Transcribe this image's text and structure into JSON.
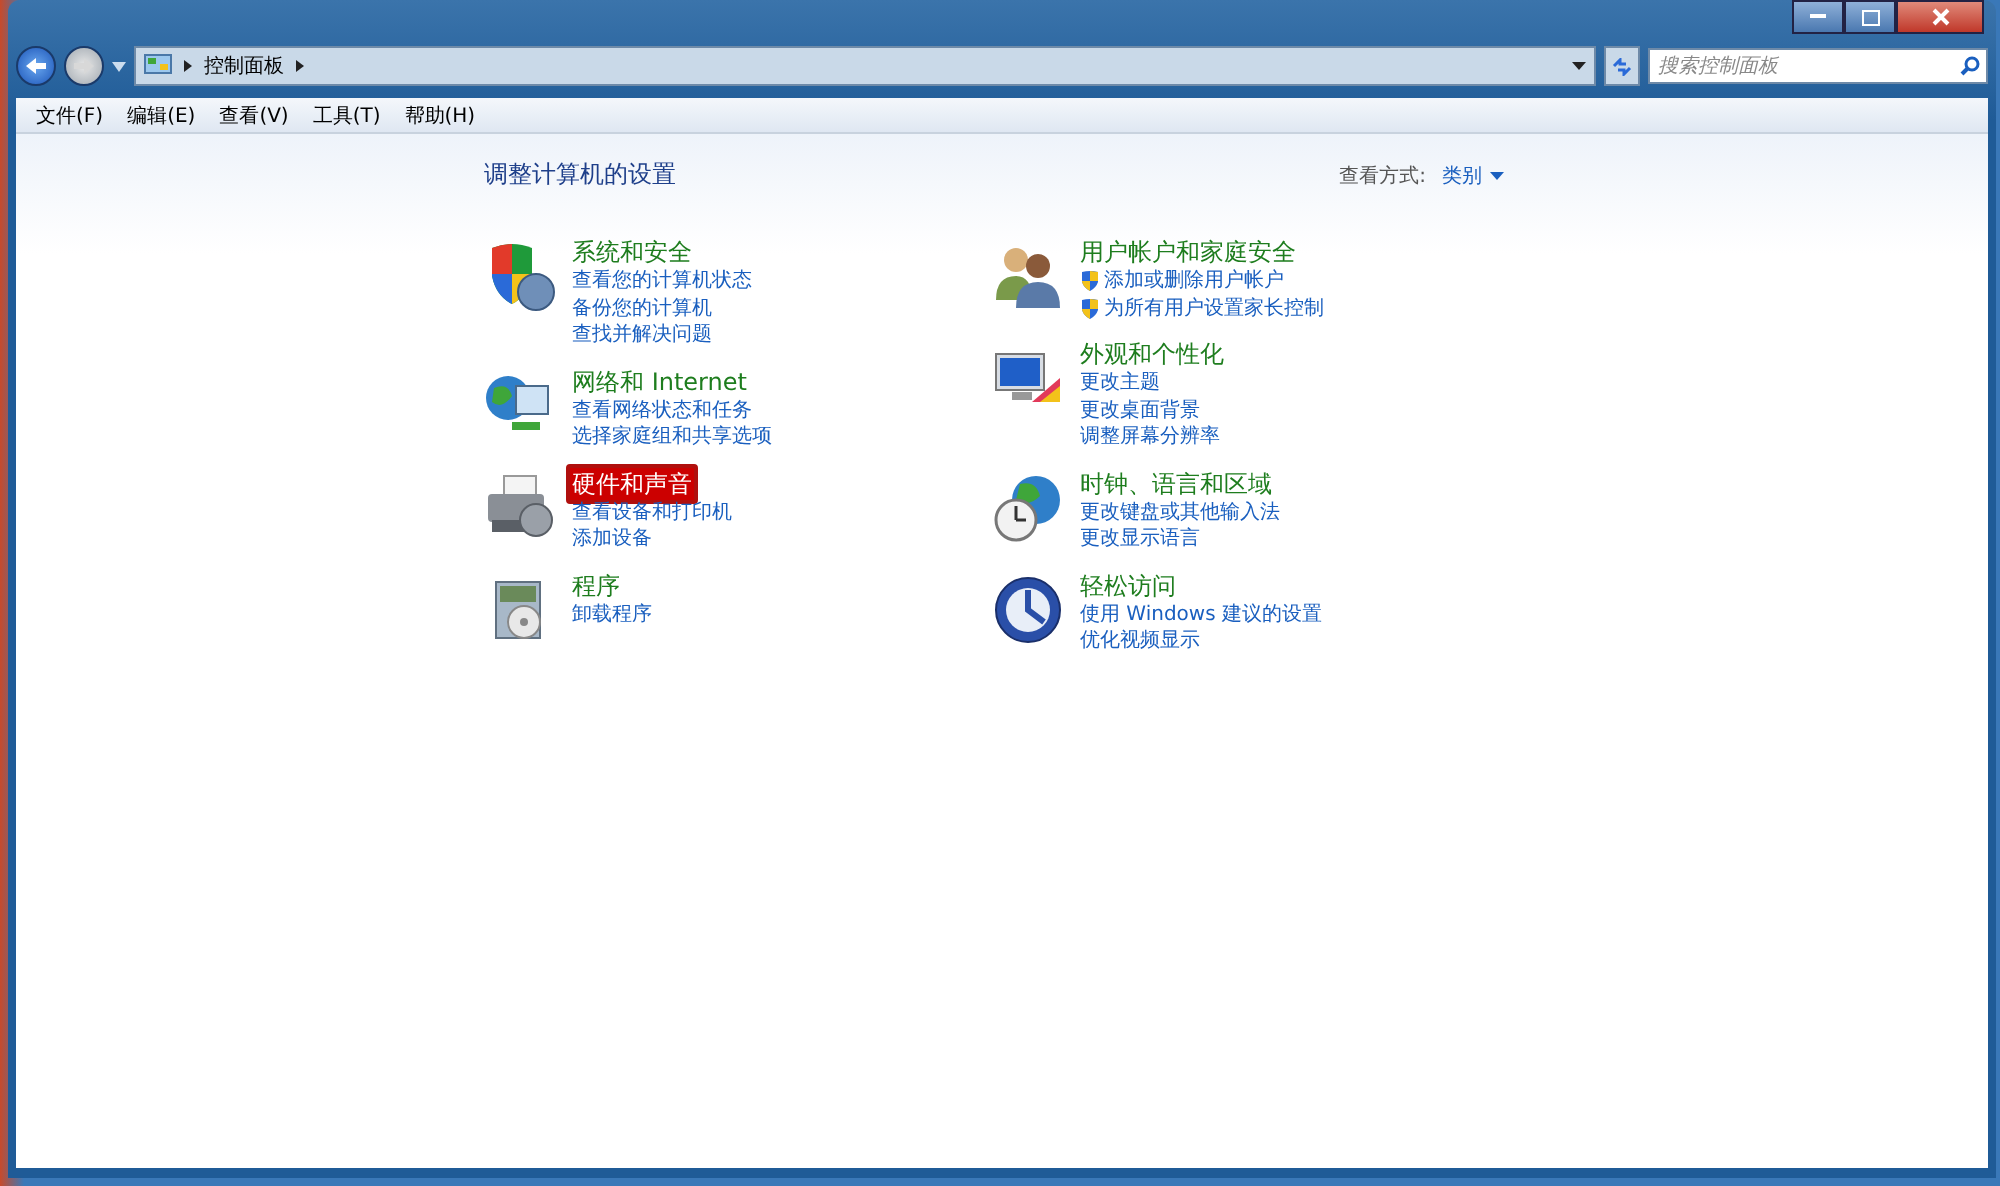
{
  "address_bar": {
    "path": [
      "控制面板"
    ]
  },
  "search": {
    "placeholder": "搜索控制面板"
  },
  "menu_bar": [
    "文件(F)",
    "编辑(E)",
    "查看(V)",
    "工具(T)",
    "帮助(H)"
  ],
  "heading": "调整计算机的设置",
  "view_by": {
    "label": "查看方式:",
    "value": "类别"
  },
  "columns": [
    [
      {
        "title": "系统和安全",
        "highlighted": false,
        "links": [
          {
            "text": "查看您的计算机状态",
            "shield": false
          },
          {
            "text": "备份您的计算机",
            "shield": false
          },
          {
            "text": "查找并解决问题",
            "shield": false
          }
        ]
      },
      {
        "title": "网络和 Internet",
        "highlighted": false,
        "links": [
          {
            "text": "查看网络状态和任务",
            "shield": false
          },
          {
            "text": "选择家庭组和共享选项",
            "shield": false
          }
        ]
      },
      {
        "title": "硬件和声音",
        "highlighted": true,
        "links": [
          {
            "text": "查看设备和打印机",
            "shield": false
          },
          {
            "text": "添加设备",
            "shield": false
          }
        ]
      },
      {
        "title": "程序",
        "highlighted": false,
        "links": [
          {
            "text": "卸载程序",
            "shield": false
          }
        ]
      }
    ],
    [
      {
        "title": "用户帐户和家庭安全",
        "highlighted": false,
        "links": [
          {
            "text": "添加或删除用户帐户",
            "shield": true
          },
          {
            "text": "为所有用户设置家长控制",
            "shield": true
          }
        ]
      },
      {
        "title": "外观和个性化",
        "highlighted": false,
        "links": [
          {
            "text": "更改主题",
            "shield": false
          },
          {
            "text": "更改桌面背景",
            "shield": false
          },
          {
            "text": "调整屏幕分辨率",
            "shield": false
          }
        ]
      },
      {
        "title": "时钟、语言和区域",
        "highlighted": false,
        "links": [
          {
            "text": "更改键盘或其他输入法",
            "shield": false
          },
          {
            "text": "更改显示语言",
            "shield": false
          }
        ]
      },
      {
        "title": "轻松访问",
        "highlighted": false,
        "links": [
          {
            "text": "使用 Windows 建议的设置",
            "shield": false
          },
          {
            "text": "优化视频显示",
            "shield": false
          }
        ]
      }
    ]
  ]
}
